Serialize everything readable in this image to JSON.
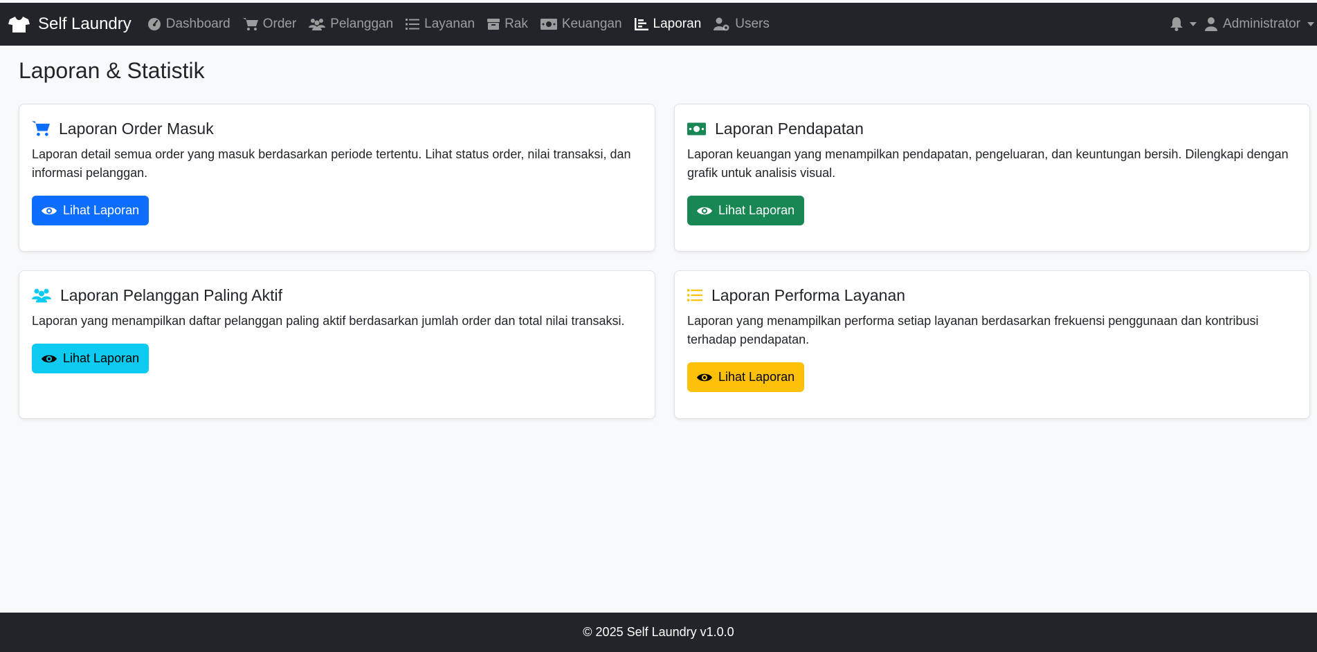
{
  "navbar": {
    "brand": "Self Laundry",
    "items": [
      {
        "label": "Dashboard",
        "icon": "gauge-icon"
      },
      {
        "label": "Order",
        "icon": "cart-icon"
      },
      {
        "label": "Pelanggan",
        "icon": "users-icon"
      },
      {
        "label": "Layanan",
        "icon": "list-icon"
      },
      {
        "label": "Rak",
        "icon": "box-icon"
      },
      {
        "label": "Keuangan",
        "icon": "money-icon"
      },
      {
        "label": "Laporan",
        "icon": "chart-icon",
        "active": true
      },
      {
        "label": "Users",
        "icon": "user-cog-icon"
      }
    ],
    "user": "Administrator"
  },
  "page": {
    "title": "Laporan & Statistik"
  },
  "cards": [
    {
      "title": "Laporan Order Masuk",
      "text": "Laporan detail semua order yang masuk berdasarkan periode tertentu. Lihat status order, nilai transaksi, dan informasi pelanggan.",
      "button": "Lihat Laporan",
      "color": "#0d6efd",
      "icon": "cart-icon"
    },
    {
      "title": "Laporan Pendapatan",
      "text": "Laporan keuangan yang menampilkan pendapatan, pengeluaran, dan keuntungan bersih. Dilengkapi dengan grafik untuk analisis visual.",
      "button": "Lihat Laporan",
      "color": "#198754",
      "icon": "money-icon"
    },
    {
      "title": "Laporan Pelanggan Paling Aktif",
      "text": "Laporan yang menampilkan daftar pelanggan paling aktif berdasarkan jumlah order dan total nilai transaksi.",
      "button": "Lihat Laporan",
      "color": "#0dcaf0",
      "icon": "users-icon"
    },
    {
      "title": "Laporan Performa Layanan",
      "text": "Laporan yang menampilkan performa setiap layanan berdasarkan frekuensi penggunaan dan kontribusi terhadap pendapatan.",
      "button": "Lihat Laporan",
      "color": "#ffc107",
      "icon": "list-icon"
    }
  ],
  "footer": {
    "text": "© 2025 Self Laundry v1.0.0"
  }
}
